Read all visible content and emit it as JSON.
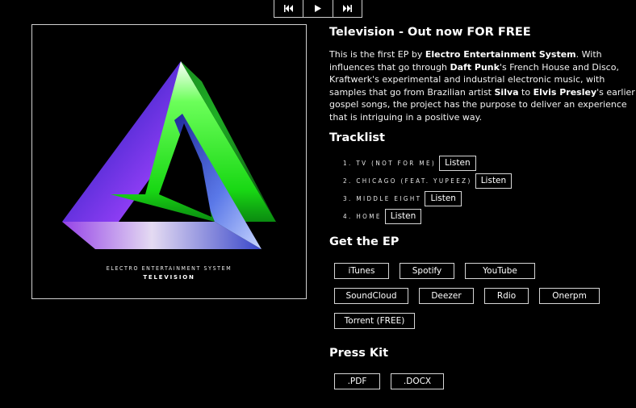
{
  "player": {
    "controls": [
      {
        "name": "previous-button",
        "icon": "previous-track-icon"
      },
      {
        "name": "play-button",
        "icon": "play-icon"
      },
      {
        "name": "next-button",
        "icon": "next-track-icon"
      }
    ]
  },
  "cover": {
    "artist": "ELECTRO ENTERTAINMENT SYSTEM",
    "title": "TELEVISION",
    "colors": {
      "green": "#1fe01a",
      "purple": "#7a3cf0",
      "blue": "#3a46d0",
      "white": "#ffffff"
    }
  },
  "album": {
    "title": "Television - Out now FOR FREE",
    "description": {
      "p1": "This is the first EP by ",
      "b1": "Electro Entertainment System",
      "p2": ". With",
      "p3": "influences that go through ",
      "b2": "Daft Punk",
      "p4": "'s French House and Disco,",
      "p5": "Kraftwerk's experimental and industrial electronic music, with",
      "p6": "samples that go from Brazilian artist ",
      "b3": "Silva",
      "p7": " to ",
      "b4": "Elvis Presley",
      "p8": "'s earlier",
      "p9": "gospel songs, the project has the purpose to deliver an experience",
      "p10": "that is intriguing in a positive way."
    }
  },
  "tracklist": {
    "title": "Tracklist",
    "tracks": [
      {
        "name": "1. TV (NOT FOR ME)",
        "button": "Listen"
      },
      {
        "name": "2. CHICAGO (FEAT. YUPEEZ)",
        "button": "Listen"
      },
      {
        "name": "3. MIDDLE EIGHT",
        "button": "Listen"
      },
      {
        "name": "4. HOME",
        "button": "Listen"
      }
    ]
  },
  "get_ep": {
    "title": "Get the EP",
    "rows": [
      [
        "iTunes",
        "Spotify",
        "YouTube"
      ],
      [
        "SoundCloud",
        "Deezer",
        "Rdio",
        "Onerpm"
      ],
      [
        "Torrent (FREE)"
      ]
    ]
  },
  "press_kit": {
    "title": "Press Kit",
    "files": [
      ".PDF",
      ".DOCX"
    ]
  }
}
